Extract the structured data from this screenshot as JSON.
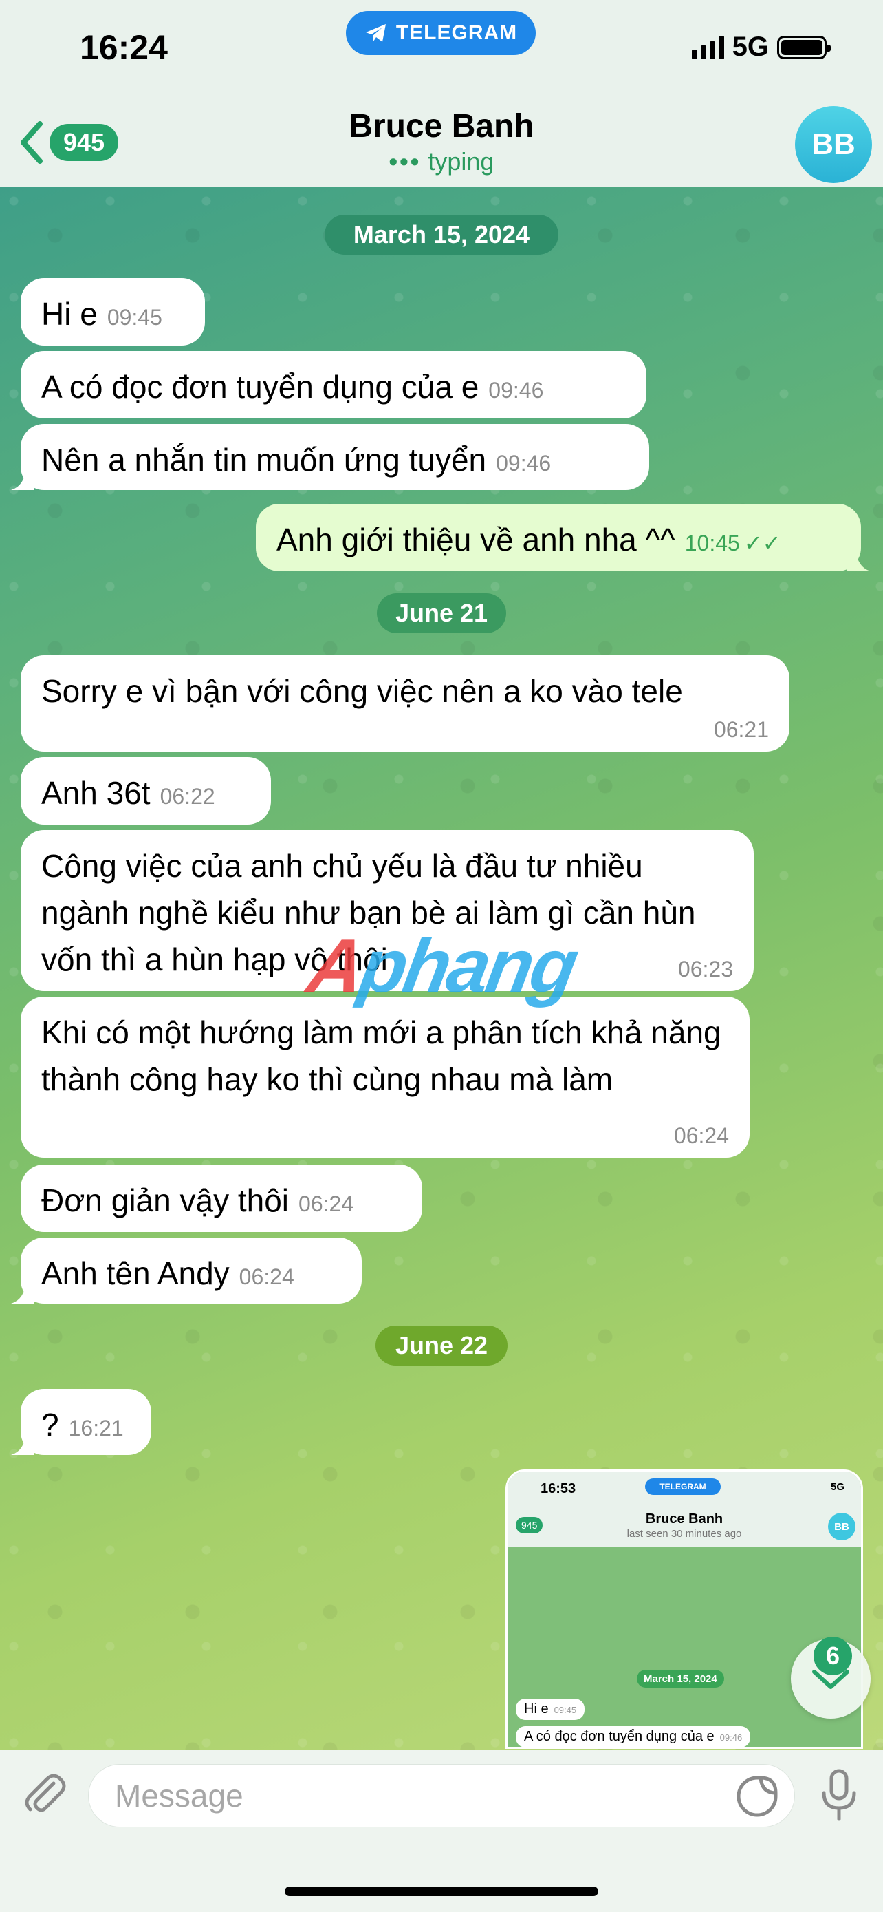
{
  "status_bar": {
    "time": "16:24",
    "app_pill": "TELEGRAM",
    "network": "5G"
  },
  "header": {
    "back_count": "945",
    "contact_name": "Bruce Banh",
    "status": "typing",
    "avatar_initials": "BB"
  },
  "dates": [
    "March 15, 2024",
    "June 21",
    "June 22"
  ],
  "messages": [
    {
      "text": "Hi e",
      "time": "09:45"
    },
    {
      "text": "A có đọc đơn tuyển dụng của e",
      "time": "09:46"
    },
    {
      "text": "Nên a nhắn tin muốn ứng tuyển",
      "time": "09:46"
    },
    {
      "text": "Anh giới thiệu về anh nha ^^",
      "time": "10:45"
    },
    {
      "text": "Sorry e vì bận với công việc nên a ko vào tele",
      "time": "06:21"
    },
    {
      "text": "Anh 36t",
      "time": "06:22"
    },
    {
      "text": "Công việc của anh chủ yếu là đầu tư nhiều ngành nghề kiểu như bạn bè ai làm gì cần hùn vốn thì a hùn hạp vô thôi",
      "time": "06:23"
    },
    {
      "text": "Khi có một hướng làm mới a phân tích khả năng thành công hay ko thì cùng nhau mà làm",
      "time": "06:24"
    },
    {
      "text": "Đơn giản vậy thôi",
      "time": "06:24"
    },
    {
      "text": "Anh tên Andy",
      "time": "06:24"
    },
    {
      "text": "?",
      "time": "16:21"
    }
  ],
  "thumbnail": {
    "time": "16:53",
    "app_pill": "TELEGRAM",
    "network": "5G",
    "back_count": "945",
    "contact_name": "Bruce Banh",
    "status": "last seen 30 minutes ago",
    "avatar_initials": "BB",
    "date": "March 15, 2024",
    "messages": [
      {
        "text": "Hi e",
        "time": "09:45"
      },
      {
        "text": "A có đọc đơn tuyển dụng của e",
        "time": "09:46"
      }
    ]
  },
  "scroll_badge": "6",
  "watermark": {
    "part1": "A",
    "part2": "phang"
  },
  "input": {
    "placeholder": "Message",
    "value": ""
  },
  "colors": {
    "accent_green": "#26a46a",
    "outgoing_bubble": "#e5fcd0",
    "telegram_blue": "#1f87e8"
  }
}
